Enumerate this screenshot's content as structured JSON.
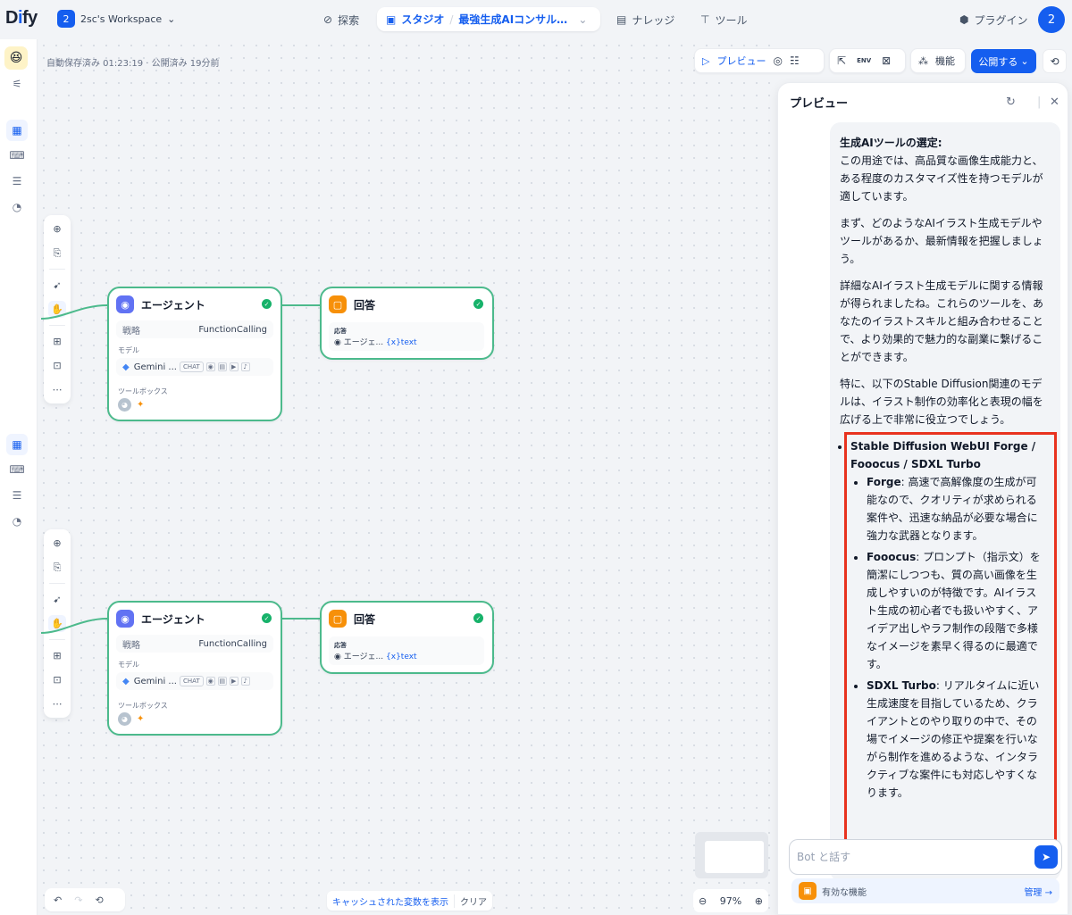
{
  "header": {
    "logo": "Dify",
    "workspace_badge": "2",
    "workspace_name": "2sc's Workspace",
    "nav_explore": "探索",
    "nav_studio": "スタジオ",
    "nav_app": "最強生成AIコンサルエ...",
    "nav_knowledge": "ナレッジ",
    "nav_tools": "ツール",
    "nav_plugins": "プラグイン",
    "avatar": "2"
  },
  "workflow": {
    "autosave": "自動保存済み 01:23:19 · 公開済み 19分前",
    "preview_button": "プレビュー",
    "features_button": "機能",
    "publish_button": "公開する",
    "env_label": "ENV"
  },
  "nodes": [
    {
      "agent_title": "エージェント",
      "strategy_label": "戦略",
      "strategy_value": "FunctionCalling",
      "model_label": "モデル",
      "model_name": "Gemini ...",
      "model_chip": "CHAT",
      "toolbox_label": "ツールボックス",
      "answer_title": "回答",
      "response_label": "応答",
      "response_source": "エージェ...",
      "response_var": "{x}text"
    },
    {
      "agent_title": "エージェント",
      "strategy_label": "戦略",
      "strategy_value": "FunctionCalling",
      "model_label": "モデル",
      "model_name": "Gemini ...",
      "model_chip": "CHAT",
      "toolbox_label": "ツールボックス",
      "answer_title": "回答",
      "response_label": "応答",
      "response_source": "エージェ...",
      "response_var": "{x}text"
    }
  ],
  "canvas_bottom": {
    "cache_button": "キャッシュされた変数を表示",
    "clear_button": "クリア",
    "zoom": "97%"
  },
  "preview": {
    "title": "プレビュー",
    "heading": "生成AIツールの選定:",
    "p1": "この用途では、高品質な画像生成能力と、ある程度のカスタマイズ性を持つモデルが適しています。",
    "p2": "まず、どのようなAIイラスト生成モデルやツールがあるか、最新情報を把握しましょう。",
    "p3": "詳細なAIイラスト生成モデルに関する情報が得られましたね。これらのツールを、あなたのイラストスキルと組み合わせることで、より効果的で魅力的な副業に繋げることができます。",
    "p4": "特に、以下のStable Diffusion関連のモデルは、イラスト制作の効率化と表現の幅を広げる上で非常に役立つでしょう。",
    "list_title": "Stable Diffusion WebUI Forge / Fooocus / SDXL Turbo",
    "items": [
      {
        "name": "Forge",
        "text": ": 高速で高解像度の生成が可能なので、クオリティが求められる案件や、迅速な納品が必要な場合に強力な武器となります。"
      },
      {
        "name": "Fooocus",
        "text": ": プロンプト（指示文）を簡潔にしつつも、質の高い画像を生成しやすいのが特徴です。AIイラスト生成の初心者でも扱いやすく、アイデア出しやラフ制作の段階で多様なイメージを素早く得るのに最適です。"
      },
      {
        "name": "SDXL Turbo",
        "text": ": リアルタイムに近い生成速度を目指しているため、クライアントとのやり取りの中で、その場でイメージの修正や提案を行いながら制作を進めるような、インタラクティブな案件にも対応しやすくなります。"
      }
    ],
    "input_placeholder": "Bot と話す",
    "features_label": "有効な機能",
    "manage_link": "管理 →"
  },
  "colors": {
    "accent": "#155eef",
    "node_border": "#4cba8c",
    "highlight": "#e8321e",
    "agent_icon": "#6172f3",
    "answer_icon": "#f79009"
  }
}
